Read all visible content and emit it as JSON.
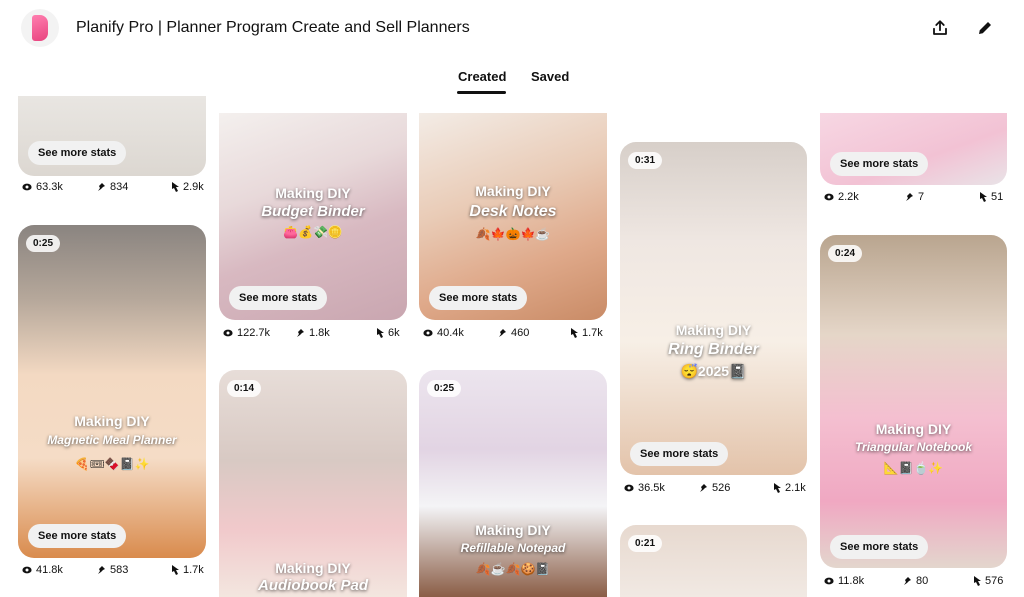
{
  "header": {
    "title": "Planify Pro | Planner Program Create and Sell Planners"
  },
  "tabs": [
    {
      "label": "Created",
      "active": true
    },
    {
      "label": "Saved",
      "active": false
    }
  ],
  "see_more_label": "See more stats",
  "cards": [
    {
      "stats": {
        "views": "63.3k",
        "saves": "834",
        "clicks": "2.9k"
      }
    },
    {
      "duration": "0:25",
      "title1": "Making DIY",
      "title2": "Magnetic Meal Planner",
      "emoji": "🍕🎟🍫📓✨",
      "stats": {
        "views": "41.8k",
        "saves": "583",
        "clicks": "1.7k"
      }
    },
    {
      "title1": "Making DIY",
      "title2": "Budget Binder",
      "emoji": "👛💰💸🪙",
      "stats": {
        "views": "122.7k",
        "saves": "1.8k",
        "clicks": "6k"
      }
    },
    {
      "duration": "0:14",
      "title1": "Making DIY",
      "title2": "Audiobook Pad"
    },
    {
      "title1": "Making DIY",
      "title2": "Desk Notes",
      "emoji": "🍂🍁🎃🍁☕",
      "stats": {
        "views": "40.4k",
        "saves": "460",
        "clicks": "1.7k"
      }
    },
    {
      "duration": "0:25",
      "title1": "Making DIY",
      "title2": "Refillable Notepad",
      "emoji": "🍂☕🍂🍪📓"
    },
    {
      "duration": "0:31",
      "title1": "Making DIY",
      "title2": "Ring Binder",
      "line3": "😴2025📓",
      "stats": {
        "views": "36.5k",
        "saves": "526",
        "clicks": "2.1k"
      }
    },
    {
      "duration": "0:21"
    },
    {
      "stats": {
        "views": "2.2k",
        "saves": "7",
        "clicks": "51"
      }
    },
    {
      "duration": "0:24",
      "title1": "Making DIY",
      "title2": "Triangular Notebook",
      "emoji": "📐📓🍵✨",
      "stats": {
        "views": "11.8k",
        "saves": "80",
        "clicks": "576"
      }
    }
  ]
}
